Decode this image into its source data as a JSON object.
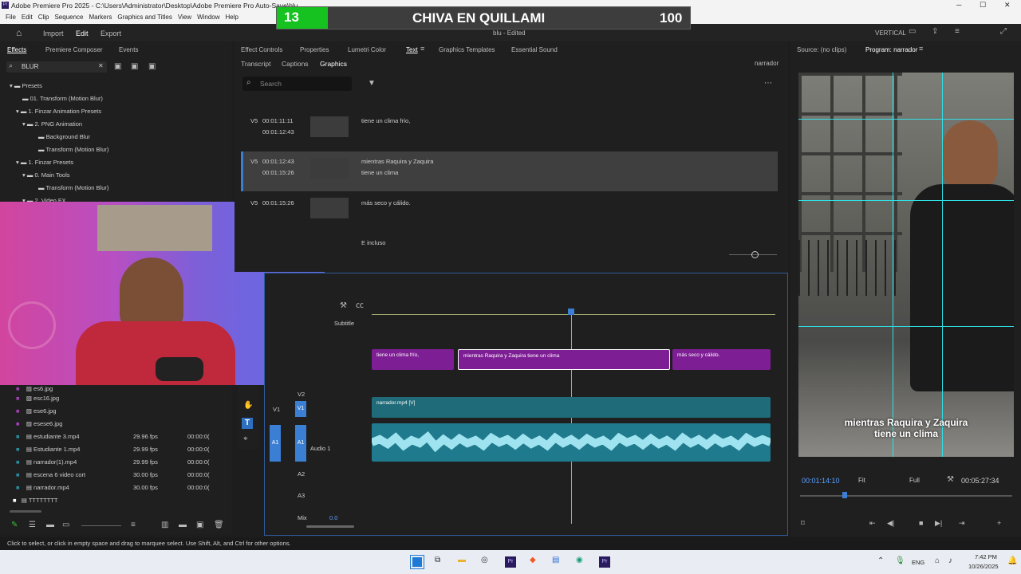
{
  "titlebar": {
    "title": "Adobe Premiere Pro 2025 - C:\\Users\\Administrator\\Desktop\\Adobe Premiere Pro Auto-Save\\blu"
  },
  "menu": [
    "File",
    "Edit",
    "Clip",
    "Sequence",
    "Markers",
    "Graphics and Titles",
    "View",
    "Window",
    "Help"
  ],
  "scoreboard": {
    "left": "13",
    "title": "CHIVA EN QUILLAMI",
    "right": "100"
  },
  "workspace": {
    "tabs": [
      "Import",
      "Edit",
      "Export"
    ],
    "project": "blu - Edited",
    "layout": "VERTICAL"
  },
  "effects": {
    "tabs": [
      "Effects",
      "Premiere Composer",
      "Events"
    ],
    "search": "BLUR",
    "tree": [
      "Presets",
      "01. Transform (Motion Blur)",
      "1. Finzar Animation Presets",
      "2. PNG Animation",
      "Background Blur",
      "Transform (Motion Blur)",
      "1. Finzar Presets",
      "0. Main Tools",
      "Transform (Motion Blur)",
      "2. Video FX"
    ]
  },
  "project_items": [
    {
      "name": "es6.jpg",
      "fps": "",
      "dur": ""
    },
    {
      "name": "esc16.jpg",
      "fps": "",
      "dur": ""
    },
    {
      "name": "ese6.jpg",
      "fps": "",
      "dur": ""
    },
    {
      "name": "esese6.jpg",
      "fps": "",
      "dur": ""
    },
    {
      "name": "estudiante 3.mp4",
      "fps": "29.96 fps",
      "dur": "00:00:0("
    },
    {
      "name": "Estudiante 1.mp4",
      "fps": "29.99 fps",
      "dur": "00:00:0("
    },
    {
      "name": "narrador(1).mp4",
      "fps": "29.99 fps",
      "dur": "00:00:0("
    },
    {
      "name": "escena 6 video cort",
      "fps": "30.00 fps",
      "dur": "00:00:0("
    },
    {
      "name": "narrador.mp4",
      "fps": "30.00 fps",
      "dur": "00:00:0("
    },
    {
      "name": "TTTTTTTT",
      "fps": "",
      "dur": ""
    }
  ],
  "center_tabs": [
    "Effect Controls",
    "Properties",
    "Lumetri Color",
    "Text",
    "Graphics Templates",
    "Essential Sound"
  ],
  "text_tabs": [
    "Transcript",
    "Captions",
    "Graphics"
  ],
  "text_panel": {
    "narrator": "narrador",
    "search_placeholder": "Search",
    "captions": [
      {
        "track": "V5",
        "in": "00:01:11:11",
        "out": "00:01:12:43",
        "text1": "tiene un clima frío,",
        "text2": ""
      },
      {
        "track": "V5",
        "in": "00:01:12:43",
        "out": "00:01:15:26",
        "text1": "mientras Raquira y Zaquira",
        "text2": "tiene un clima"
      },
      {
        "track": "V5",
        "in": "00:01:15:26",
        "out": "",
        "text1": "más seco y cálido.",
        "text2": ""
      },
      {
        "track": "",
        "in": "",
        "out": "",
        "text1": "E incluso",
        "text2": ""
      }
    ]
  },
  "timeline": {
    "subtitle": "Subtitle",
    "clips": [
      "tiene un clima frío,",
      "mientras Raquira y Zaquira tiene un clima",
      "más seco y cálido."
    ],
    "video_clip": "narrador.mp4 [V]",
    "audio_label": "Audio 1",
    "tracks": [
      "V2",
      "V1",
      "A1",
      "A2",
      "A3"
    ],
    "mix": "Mix",
    "mix_val": "0.0"
  },
  "monitor": {
    "source": "Source: (no clips)",
    "program": "Program: narrador",
    "caption_line1": "mientras Raquira y Zaquira",
    "caption_line2": "tiene un clima",
    "timecode": "00:01:14:10",
    "fit": "Fit",
    "quality": "Full",
    "duration": "00:05:27:34"
  },
  "status": "Click to select, or click in empty space and drag to marquee select. Use Shift, Alt, and Ctrl for other options.",
  "taskbar": {
    "lang": "ENG",
    "time": "7:42 PM",
    "date": "10/26/2025"
  }
}
